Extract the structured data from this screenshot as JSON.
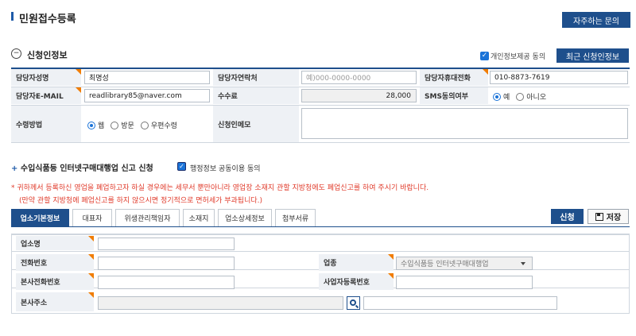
{
  "page": {
    "title": "민원접수등록",
    "faq_button": "자주하는 문의"
  },
  "applicant": {
    "section_title": "신청인정보",
    "consent_label": "개인정보제공 동의",
    "recent_button": "최근 신청인정보",
    "fields": {
      "name_label": "담당자성명",
      "name_value": "최명성",
      "contact_label": "담당자연락처",
      "contact_placeholder": "예)000-0000-0000",
      "mobile_label": "담당자휴대전화",
      "mobile_value": "010-8873-7619",
      "email_label": "담당자E-MAIL",
      "email_value": "readlibrary85@naver.com",
      "fee_label": "수수료",
      "fee_value": "28,000",
      "sms_label": "SMS동의여부",
      "sms_options": [
        "예",
        "아니오"
      ],
      "sms_selected": "예",
      "receive_label": "수령방법",
      "receive_options": [
        "웹",
        "방문",
        "우편수령"
      ],
      "receive_selected": "웹",
      "memo_label": "신청인메모",
      "memo_value": ""
    }
  },
  "report": {
    "title": "수입식품등 인터넷구매대행업 신고 신청",
    "share_label": "행정정보 공동이용 동의",
    "notice_line1": "* 귀하께서 등록하신 영업을 폐업하고자 하실 경우에는 세무서 뿐만아니라 영업장 소재지 관할 지방청에도 폐업신고를 하여 주시기 바랍니다.",
    "notice_line2": "(만약 관할 지방청에 폐업신고를 하지 않으시면 정기적으로 면허세가 부과됩니다.)",
    "tabs": [
      "업소기본정보",
      "대표자",
      "위생관리책임자",
      "소재지",
      "업소상세정보",
      "첨부서류"
    ],
    "active_tab": "업소기본정보",
    "apply_button": "신청",
    "save_button": "저장",
    "form": {
      "biz_name_label": "업소명",
      "phone_label": "전화번호",
      "industry_label": "업종",
      "industry_value": "수입식품등 인터넷구매대행업",
      "hq_phone_label": "본사전화번호",
      "biz_reg_label": "사업자등록번호",
      "hq_address_label": "본사주소"
    }
  },
  "colors": {
    "accent": "#1e4f8c",
    "required_marker": "#f07c00",
    "notice": "#e03a2a",
    "label_bg": "#eef1f5"
  }
}
